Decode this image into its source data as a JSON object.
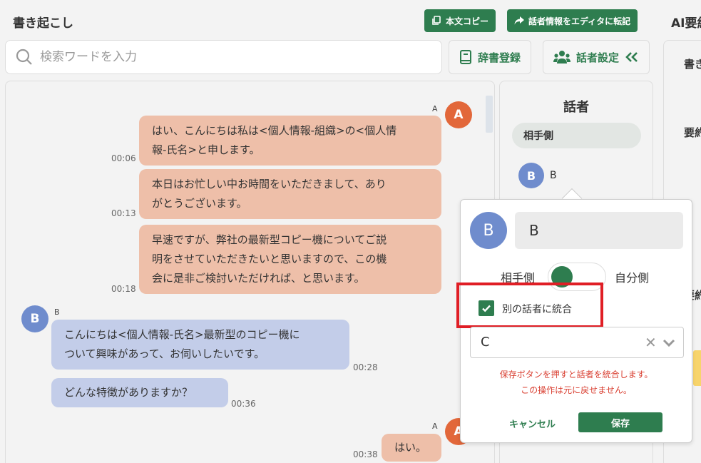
{
  "header": {
    "title": "書き起こし",
    "copy_button": "本文コピー",
    "transfer_button": "話者情報をエディタに転記",
    "ai_title": "AI要約"
  },
  "search": {
    "placeholder": "検索ワードを入力"
  },
  "toolbar": {
    "dictionary_button": "辞書登録",
    "speaker_settings_button": "話者設定"
  },
  "messages": [
    {
      "speaker": "A",
      "line1": "はい、こんにちは私は<個人情報-組織>の<個人情",
      "line2": "報-氏名>と申します。",
      "time": "00:06"
    },
    {
      "speaker": "A",
      "line1": "本日はお忙しい中お時間をいただきまして、あり",
      "line2": "がとうございます。",
      "time": "00:13"
    },
    {
      "speaker": "A",
      "line1": "早速ですが、弊社の最新型コピー機についてご説",
      "line2": "明をさせていただきたいと思いますので、この機",
      "line3": "会に是非ご検討いただければ、と思います。",
      "time": "00:18"
    },
    {
      "speaker": "B",
      "line1": "こんにちは<個人情報-氏名>最新型のコピー機に",
      "line2": "ついて興味があって、お伺いしたいです。",
      "time": "00:28"
    },
    {
      "speaker": "B",
      "line1": "どんな特徴がありますか？",
      "time": "00:36"
    },
    {
      "speaker": "A",
      "line1": "はい。",
      "time": "00:38"
    }
  ],
  "speaker_panel": {
    "heading": "話者",
    "group_label": "相手側",
    "speaker_b_avatar": "B",
    "speaker_b_name": "B"
  },
  "right_panel": {
    "label1": "書き",
    "label2": "要約",
    "label3": "要約"
  },
  "popup": {
    "avatar": "B",
    "name_value": "B",
    "toggle_left": "相手側",
    "toggle_right": "自分側",
    "merge_label": "別の話者に統合",
    "select_value": "C",
    "warning_line1": "保存ボタンを押すと話者を統合します。",
    "warning_line2": "この操作は元に戻せません。",
    "cancel_label": "キャンセル",
    "save_label": "保存"
  },
  "colors": {
    "accent": "#2e7d4f",
    "speaker_a_bubble": "#eebfa9",
    "speaker_b_bubble": "#c3cde9",
    "speaker_a_avatar": "#e2673a",
    "speaker_b_avatar": "#6f8ccd",
    "highlight_box": "#e01e25",
    "warning_text": "#d93f31"
  },
  "icons": {
    "copy": "copy-icon",
    "share": "share-arrow-icon",
    "search": "search-icon",
    "dictionary": "book-icon",
    "speakers": "users-icon",
    "collapse": "double-chevron-left-icon",
    "check": "check-icon",
    "clear": "clear-icon",
    "dropdown": "chevron-down-icon"
  }
}
